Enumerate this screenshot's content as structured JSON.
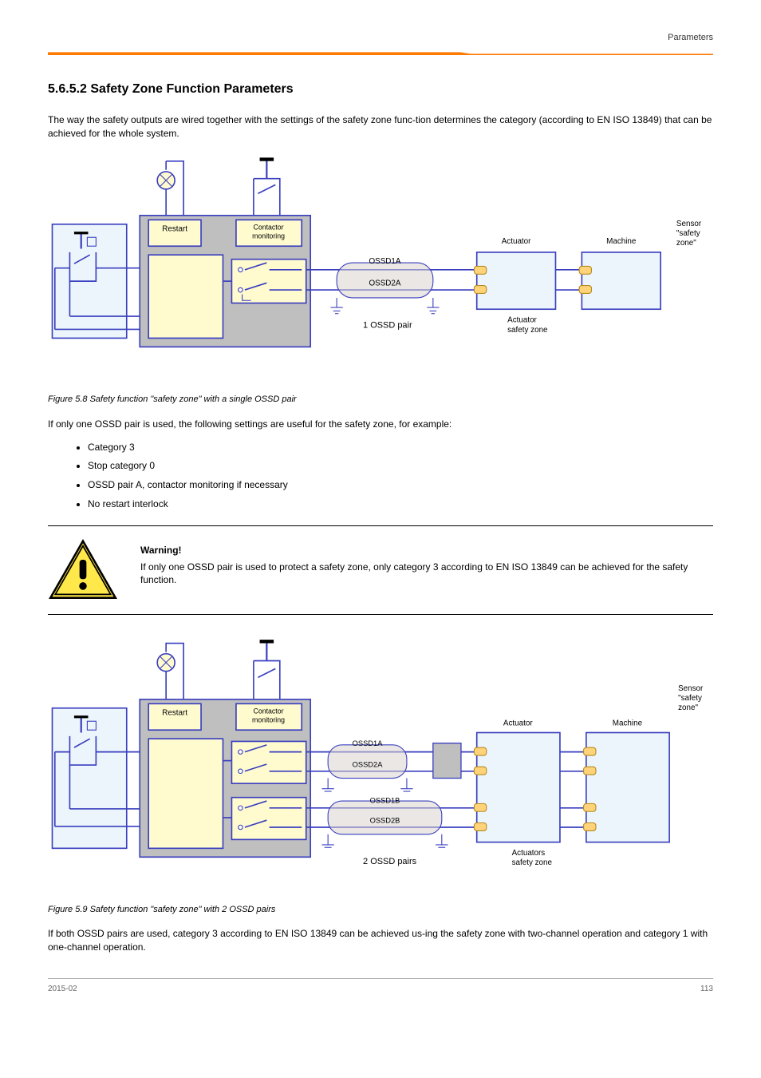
{
  "header": {
    "right": "Parameters"
  },
  "section": {
    "number_title": "5.6.5.2 Safety Zone Function Parameters",
    "intro": "The way the safety outputs are wired together with the settings of the safety zone func-tion determines the category (according to EN ISO 13849) that can be achieved for the whole system.",
    "after_fig1": "If only one OSSD pair is used, the following settings are useful for the safety zone, for example:",
    "bullets": [
      "Category 3",
      "Stop category 0",
      "OSSD pair A, contactor monitoring if necessary",
      "No restart interlock"
    ],
    "after_fig2": "If both OSSD pairs are used, category 3 according to EN ISO 13849 can be achieved us-ing the safety zone with two-channel operation and category 1 with one-channel operation."
  },
  "warning": {
    "label": "Warning!",
    "text": "If only one OSSD pair is used to protect a safety zone, only category 3 according to EN ISO 13849 can be achieved for the safety function."
  },
  "fig1": {
    "caption": "Figure 5.8 Safety function \"safety zone\" with a single OSSD pair",
    "labels": {
      "restart": "Restart",
      "contactor_mon": "Contactor\nmonitoring",
      "OSSD1A": "OSSD1A",
      "OSSD2A": "OSSD2A",
      "ossd_pair": "1 OSSD pair",
      "machine": "Machine",
      "actuator": "Actuator\nsafety\nzone",
      "sensor": "Sensor\n\"safety\nzone\""
    }
  },
  "fig2": {
    "caption": "Figure 5.9 Safety function \"safety zone\" with 2 OSSD pairs",
    "labels": {
      "restart": "Restart",
      "contactor_mon": "Contactor\nmonitoring",
      "OSSD1A": "OSSD1A",
      "OSSD2A": "OSSD2A",
      "OSSD1B": "OSSD1B",
      "OSSD2B": "OSSD2B",
      "ossd_pairs": "2 OSSD pairs",
      "machine": "Machine",
      "actuator": "Actuators\nsafety\nzone",
      "sensor": "Sensor\n\"safety\nzone\""
    }
  },
  "footer": {
    "left": "2015-02",
    "right": "113"
  }
}
